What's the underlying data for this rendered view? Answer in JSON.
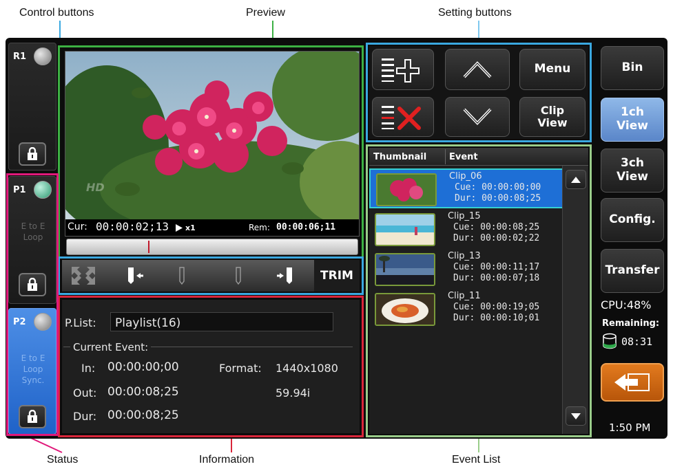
{
  "callouts": {
    "control_buttons": "Control buttons",
    "preview": "Preview",
    "setting_buttons": "Setting buttons",
    "status": "Status",
    "information": "Information",
    "event_list": "Event List"
  },
  "channels": {
    "r1": {
      "label": "R1"
    },
    "p1": {
      "label": "P1",
      "mode_line1": "E to E",
      "mode_line2": "Loop"
    },
    "p2": {
      "label": "P2",
      "mode_line1": "E to E",
      "mode_line2": "Loop",
      "mode_line3": "Sync."
    }
  },
  "preview": {
    "cur_label": "Cur:",
    "cur_time": "00:00:02;13",
    "speed": "x1",
    "rem_label": "Rem:",
    "rem_time": "00:00:06;11",
    "overlay_logo": "HD"
  },
  "trim_bar": {
    "trim_label": "TRIM"
  },
  "setting_buttons": {
    "menu": "Menu",
    "clip_view_line1": "Clip",
    "clip_view_line2": "View"
  },
  "info": {
    "plist_label": "P.List:",
    "plist_value": "Playlist(16)",
    "current_event_label": "Current Event:",
    "in_label": "In:",
    "in_value": "00:00:00;00",
    "out_label": "Out:",
    "out_value": "00:00:08;25",
    "dur_label": "Dur:",
    "dur_value": "00:00:08;25",
    "format_label": "Format:",
    "format_value": "1440x1080",
    "format_rate": "59.94i"
  },
  "event_list": {
    "col_thumbnail": "Thumbnail",
    "col_event": "Event",
    "rows": [
      {
        "name": "Clip_06",
        "cue": "Cue: 00:00:00;00",
        "dur": "Dur: 00:00:08;25",
        "selected": true
      },
      {
        "name": "Clip_15",
        "cue": "Cue: 00:00:08;25",
        "dur": "Dur: 00:00:02;22",
        "selected": false
      },
      {
        "name": "Clip_13",
        "cue": "Cue: 00:00:11;17",
        "dur": "Dur: 00:00:07;18",
        "selected": false
      },
      {
        "name": "Clip_11",
        "cue": "Cue: 00:00:19;05",
        "dur": "Dur: 00:00:10;01",
        "selected": false
      }
    ]
  },
  "right_nav": {
    "bin": "Bin",
    "view1_line1": "1ch",
    "view1_line2": "View",
    "view3_line1": "3ch",
    "view3_line2": "View",
    "config": "Config.",
    "transfer": "Transfer",
    "cpu": "CPU:48%",
    "remaining_label": "Remaining:",
    "remaining_value": "08:31",
    "clock": "1:50 PM"
  },
  "colors": {
    "preview_frame": "#3cb043",
    "setting_frame": "#3aa8e0",
    "info_frame": "#d9263a",
    "event_frame": "#9acd8a",
    "status_frame": "#e0187a",
    "selected_row": "#1e6fd6",
    "back_button": "#d86a10"
  }
}
